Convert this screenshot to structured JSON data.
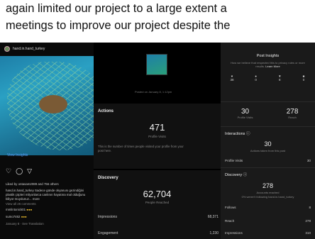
{
  "doc": {
    "line1": "again limited our project to a large extent a",
    "line2": "meetings to improve our project despite the"
  },
  "post": {
    "username": "hand.in.hand_turkey",
    "menu": "…",
    "view_insights": "View Insights",
    "likes": "Liked by ontasam2089 and 756 others",
    "caption1": "hand.in.hand_turkey Sadece günde okyanusı gezindiğini",
    "caption2": "plastik çöpleri milyonlarca canlının hayatına mal olduğunu",
    "caption3": "biliyor muydunuz... more",
    "view_comments": "View all 26 comments",
    "comment1": "mmlintonick01",
    "comment2": "sumo7462",
    "date": "January 8 · See Translation",
    "icons": [
      "heart-icon",
      "comment-icon",
      "send-icon",
      "save-icon"
    ]
  },
  "middle": {
    "posted": "Posted on January 8, 1:12pm",
    "actions_title": "Actions",
    "profile_visits": "471",
    "profile_visits_label": "Profile Visits",
    "actions_note": "This is the number of times people visited your profile from your",
    "actions_note2": "post here.",
    "discovery_title": "Discovery",
    "reached": "62,704",
    "reached_label": "People Reached",
    "impressions_label": "Impressions",
    "impressions": "68,371",
    "engagement_label": "Engagement",
    "engagement": "1,230"
  },
  "insights": {
    "title": "Post Insights",
    "note": "How we believe that respected this to privacy rules or more results.",
    "learn_more": "Learn More",
    "stats": [
      {
        "icon": "heart-icon",
        "value": "38"
      },
      {
        "icon": "comment-icon",
        "value": "0"
      },
      {
        "icon": "send-icon",
        "value": "8"
      },
      {
        "icon": "save-icon",
        "value": "0"
      }
    ],
    "profile_visits": "30",
    "profile_visits_label": "Profile Visits",
    "reach": "278",
    "reach_label": "Reach",
    "interactions_title": "Interactions ⓘ",
    "interactions_value": "30",
    "interactions_label": "Actions taken from this post",
    "profile_visits_row_label": "Profile Visits",
    "profile_visits_row": "30",
    "discovery_title": "Discovery ⓘ",
    "discovery_value": "278",
    "discovery_label": "Accounts reached",
    "discovery_sub": "0% weren't following hand.in.hand_turkey",
    "follows_label": "Follows",
    "follows": "8",
    "reach_row_label": "Reach",
    "reach_row": "278",
    "impressions_row_label": "Impressions",
    "impressions_row": "310"
  }
}
